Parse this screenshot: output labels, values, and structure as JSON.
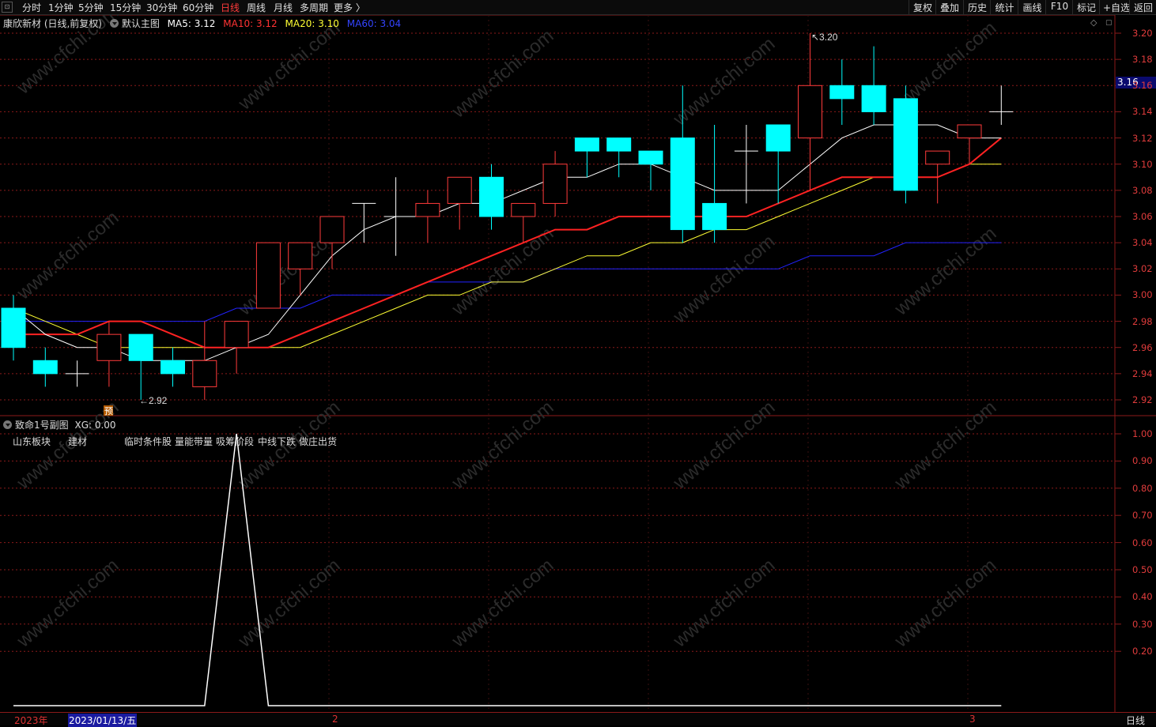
{
  "toolbar": {
    "corner": "⊡",
    "periods": [
      "分时",
      "1分钟",
      "5分钟",
      "15分钟",
      "30分钟",
      "60分钟",
      "日线",
      "周线",
      "月线",
      "多周期",
      "更多 〉"
    ],
    "active_period": "日线",
    "right_buttons": [
      "复权",
      "叠加",
      "历史",
      "统计",
      "画线",
      "F10",
      "标记",
      "+自选",
      "返回"
    ]
  },
  "main_header": {
    "stock": "康欣新材 (日线,前复权)",
    "indicator": "默认主图",
    "ma5": "MA5: 3.12",
    "ma10": "MA10: 3.12",
    "ma20": "MA20: 3.10",
    "ma60": "MA60: 3.04"
  },
  "colors": {
    "up": "#ff3b3b",
    "down": "#00ffff",
    "ma5": "#ffffff",
    "ma10": "#ff2222",
    "ma20": "#ffff33",
    "ma60": "#2222ff",
    "grid": "#8b1a1a"
  },
  "price_axis": [
    "3.20",
    "3.18",
    "3.16",
    "3.14",
    "3.12",
    "3.10",
    "3.08",
    "3.06",
    "3.04",
    "3.02",
    "3.00",
    "2.98",
    "2.96",
    "2.94",
    "2.92"
  ],
  "current_price": "3.16",
  "annotations": {
    "high": "3.20",
    "low": "2.92",
    "pre_marker": "预"
  },
  "sub_header": {
    "title": "致命1号副图",
    "xg": "XG: 0.00"
  },
  "sub_tags": [
    "山东板块",
    "建材",
    "临时条件股",
    "量能带量",
    "吸筹阶段",
    "中线下跌",
    "做庄出货"
  ],
  "sub_axis": [
    "1.00",
    "0.90",
    "0.80",
    "0.70",
    "0.60",
    "0.50",
    "0.40",
    "0.30",
    "0.20"
  ],
  "bottom": {
    "year": "2023年",
    "selected_date": "2023/01/13/五",
    "month_2": "2",
    "month_3": "3",
    "period": "日线"
  },
  "watermark": "www.cfchi.com",
  "chart_data": {
    "type": "candlestick",
    "candles": [
      {
        "o": 2.99,
        "h": 3.0,
        "l": 2.95,
        "c": 2.96
      },
      {
        "o": 2.95,
        "h": 2.96,
        "l": 2.93,
        "c": 2.94
      },
      {
        "o": 2.94,
        "h": 2.95,
        "l": 2.93,
        "c": 2.94
      },
      {
        "o": 2.95,
        "h": 2.98,
        "l": 2.93,
        "c": 2.97
      },
      {
        "o": 2.97,
        "h": 2.97,
        "l": 2.92,
        "c": 2.95
      },
      {
        "o": 2.95,
        "h": 2.96,
        "l": 2.93,
        "c": 2.94
      },
      {
        "o": 2.93,
        "h": 2.98,
        "l": 2.92,
        "c": 2.95
      },
      {
        "o": 2.96,
        "h": 2.98,
        "l": 2.94,
        "c": 2.98
      },
      {
        "o": 2.99,
        "h": 3.04,
        "l": 2.99,
        "c": 3.04
      },
      {
        "o": 3.02,
        "h": 3.04,
        "l": 3.0,
        "c": 3.04
      },
      {
        "o": 3.04,
        "h": 3.06,
        "l": 3.02,
        "c": 3.06
      },
      {
        "o": 3.07,
        "h": 3.07,
        "l": 3.04,
        "c": 3.07
      },
      {
        "o": 3.06,
        "h": 3.09,
        "l": 3.03,
        "c": 3.06
      },
      {
        "o": 3.06,
        "h": 3.08,
        "l": 3.04,
        "c": 3.07
      },
      {
        "o": 3.07,
        "h": 3.09,
        "l": 3.05,
        "c": 3.09
      },
      {
        "o": 3.09,
        "h": 3.1,
        "l": 3.05,
        "c": 3.06
      },
      {
        "o": 3.06,
        "h": 3.07,
        "l": 3.04,
        "c": 3.07
      },
      {
        "o": 3.07,
        "h": 3.11,
        "l": 3.06,
        "c": 3.1
      },
      {
        "o": 3.12,
        "h": 3.12,
        "l": 3.09,
        "c": 3.11
      },
      {
        "o": 3.12,
        "h": 3.12,
        "l": 3.09,
        "c": 3.11
      },
      {
        "o": 3.11,
        "h": 3.11,
        "l": 3.08,
        "c": 3.1
      },
      {
        "o": 3.12,
        "h": 3.16,
        "l": 3.04,
        "c": 3.05
      },
      {
        "o": 3.07,
        "h": 3.13,
        "l": 3.04,
        "c": 3.05
      },
      {
        "o": 3.11,
        "h": 3.13,
        "l": 3.07,
        "c": 3.11
      },
      {
        "o": 3.13,
        "h": 3.13,
        "l": 3.07,
        "c": 3.11
      },
      {
        "o": 3.12,
        "h": 3.2,
        "l": 3.08,
        "c": 3.16
      },
      {
        "o": 3.16,
        "h": 3.18,
        "l": 3.13,
        "c": 3.15
      },
      {
        "o": 3.16,
        "h": 3.19,
        "l": 3.13,
        "c": 3.14
      },
      {
        "o": 3.15,
        "h": 3.16,
        "l": 3.07,
        "c": 3.08
      },
      {
        "o": 3.1,
        "h": 3.11,
        "l": 3.07,
        "c": 3.11
      },
      {
        "o": 3.12,
        "h": 3.13,
        "l": 3.1,
        "c": 3.13
      },
      {
        "o": 3.14,
        "h": 3.16,
        "l": 3.13,
        "c": 3.14
      }
    ],
    "ma5": [
      2.99,
      2.97,
      2.96,
      2.96,
      2.95,
      2.95,
      2.95,
      2.96,
      2.97,
      3.0,
      3.03,
      3.05,
      3.06,
      3.06,
      3.07,
      3.07,
      3.08,
      3.09,
      3.09,
      3.1,
      3.1,
      3.09,
      3.08,
      3.08,
      3.08,
      3.1,
      3.12,
      3.13,
      3.13,
      3.13,
      3.12,
      3.12
    ],
    "ma10": [
      2.97,
      2.97,
      2.97,
      2.98,
      2.98,
      2.97,
      2.96,
      2.96,
      2.96,
      2.97,
      2.98,
      2.99,
      3.0,
      3.01,
      3.02,
      3.03,
      3.04,
      3.05,
      3.05,
      3.06,
      3.06,
      3.06,
      3.06,
      3.06,
      3.07,
      3.08,
      3.09,
      3.09,
      3.09,
      3.09,
      3.1,
      3.12
    ],
    "ma20": [
      2.99,
      2.98,
      2.97,
      2.96,
      2.96,
      2.96,
      2.96,
      2.96,
      2.96,
      2.96,
      2.97,
      2.98,
      2.99,
      3.0,
      3.0,
      3.01,
      3.01,
      3.02,
      3.03,
      3.03,
      3.04,
      3.04,
      3.05,
      3.05,
      3.06,
      3.07,
      3.08,
      3.09,
      3.09,
      3.09,
      3.1,
      3.1
    ],
    "ma60": [
      2.98,
      2.98,
      2.98,
      2.98,
      2.98,
      2.98,
      2.98,
      2.99,
      2.99,
      2.99,
      3.0,
      3.0,
      3.0,
      3.01,
      3.01,
      3.01,
      3.01,
      3.02,
      3.02,
      3.02,
      3.02,
      3.02,
      3.02,
      3.02,
      3.02,
      3.03,
      3.03,
      3.03,
      3.04,
      3.04,
      3.04,
      3.04
    ],
    "xg": [
      0,
      0,
      0,
      0,
      0,
      0,
      0,
      1,
      0,
      0,
      0,
      0,
      0,
      0,
      0,
      0,
      0,
      0,
      0,
      0,
      0,
      0,
      0,
      0,
      0,
      0,
      0,
      0,
      0,
      0,
      0,
      0
    ],
    "price_range": [
      2.91,
      3.21
    ],
    "sub_range": [
      0,
      1
    ]
  }
}
